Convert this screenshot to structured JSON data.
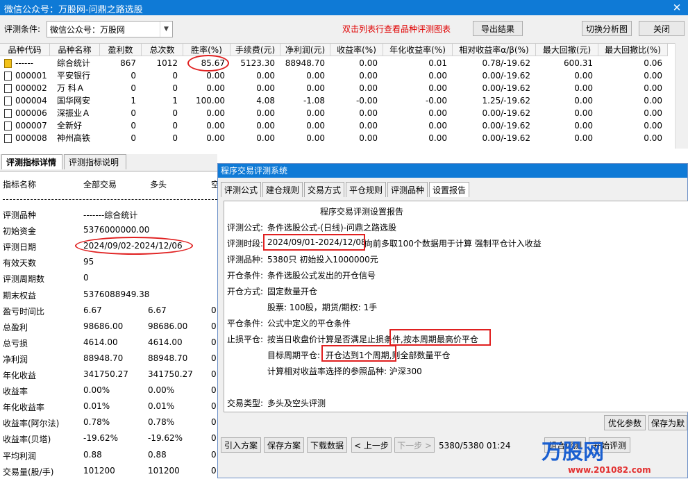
{
  "window": {
    "title": "微信公众号：万股网-问鼎之路选股",
    "close_glyph": "✕"
  },
  "toolbar": {
    "condition_label": "评测条件:",
    "condition_value": "微信公众号：万股网",
    "hint": "双击列表行查看品种评测图表",
    "export_label": "导出结果",
    "switch_label": "切换分析图",
    "close_label": "关闭"
  },
  "grid": {
    "headers": [
      "品种代码",
      "品种名称",
      "盈利数",
      "总次数",
      "胜率(%)",
      "手续费(元)",
      "净利润(元)",
      "收益率(%)",
      "年化收益率(%)",
      "相对收益率α/β(%)",
      "最大回撤(元)",
      "最大回撤比(%)"
    ],
    "rows": [
      [
        "------",
        "综合统计",
        "867",
        "1012",
        "85.67",
        "5123.30",
        "88948.70",
        "0.00",
        "0.01",
        "0.78/-19.62",
        "600.31",
        "0.06"
      ],
      [
        "000001",
        "平安银行",
        "0",
        "0",
        "0.00",
        "0.00",
        "0.00",
        "0.00",
        "0.00",
        "0.00/-19.62",
        "0.00",
        "0.00"
      ],
      [
        "000002",
        "万 科Ａ",
        "0",
        "0",
        "0.00",
        "0.00",
        "0.00",
        "0.00",
        "0.00",
        "0.00/-19.62",
        "0.00",
        "0.00"
      ],
      [
        "000004",
        "国华网安",
        "1",
        "1",
        "100.00",
        "4.08",
        "-1.08",
        "-0.00",
        "-0.00",
        "1.25/-19.62",
        "0.00",
        "0.00"
      ],
      [
        "000006",
        "深振业Ａ",
        "0",
        "0",
        "0.00",
        "0.00",
        "0.00",
        "0.00",
        "0.00",
        "0.00/-19.62",
        "0.00",
        "0.00"
      ],
      [
        "000007",
        "全新好",
        "0",
        "0",
        "0.00",
        "0.00",
        "0.00",
        "0.00",
        "0.00",
        "0.00/-19.62",
        "0.00",
        "0.00"
      ],
      [
        "000008",
        "神州高铁",
        "0",
        "0",
        "0.00",
        "0.00",
        "0.00",
        "0.00",
        "0.00",
        "0.00/-19.62",
        "0.00",
        "0.00"
      ]
    ]
  },
  "left_tabs": [
    "评测指标详情",
    "评测指标说明"
  ],
  "left_panel": {
    "headers": [
      "指标名称",
      "全部交易",
      "多头",
      "空"
    ],
    "rows": [
      [
        "评测品种",
        "-------综合统计",
        "",
        ""
      ],
      [
        "初始资金",
        "5376000000.00",
        "",
        ""
      ],
      [
        "评测日期",
        "2024/09/02-2024/12/06",
        "",
        ""
      ],
      [
        "有效天数",
        "95",
        "",
        ""
      ],
      [
        "评测周期数",
        "0",
        "",
        ""
      ],
      [
        "期末权益",
        "5376088949.38",
        "",
        ""
      ],
      [
        "盈亏时间比",
        "6.67",
        "6.67",
        "0"
      ],
      [
        "总盈利",
        "98686.00",
        "98686.00",
        "0"
      ],
      [
        "总亏损",
        "4614.00",
        "4614.00",
        "0"
      ],
      [
        "净利润",
        "88948.70",
        "88948.70",
        "0"
      ],
      [
        "年化收益",
        "341750.27",
        "341750.27",
        "0"
      ],
      [
        "收益率",
        "0.00%",
        "0.00%",
        "0"
      ],
      [
        "年化收益率",
        "0.01%",
        "0.01%",
        "0"
      ],
      [
        "收益率(阿尔法)",
        "0.78%",
        "0.78%",
        "0"
      ],
      [
        "收益率(贝塔)",
        "-19.62%",
        "-19.62%",
        "0"
      ],
      [
        "平均利润",
        "0.88",
        "0.88",
        "0"
      ],
      [
        "交易量(股/手)",
        "101200",
        "101200",
        "0"
      ]
    ]
  },
  "dialog": {
    "title": "程序交易评测系统",
    "tabs": [
      "评测公式",
      "建仓规则",
      "交易方式",
      "平仓规则",
      "评测品种",
      "设置报告"
    ],
    "report_title": "程序交易评测设置报告",
    "lines": {
      "formula_label": "评测公式:",
      "formula_value": "条件选股公式-(日线)-问鼎之路选股",
      "period_label": "评测时段:",
      "period_value": "2024/09/01-2024/12/08",
      "period_suffix": "向前多取100个数据用于计算 强制平仓计入收益",
      "variety_label": "评测品种:",
      "variety_value": "5380只 初始投入1000000元",
      "open_cond_label": "开仓条件:",
      "open_cond_value": "条件选股公式发出的开仓信号",
      "open_mode_label": "开仓方式:",
      "open_mode_value": "固定数量开仓",
      "stock_qty": "股票: 100股，期货/期权: 1手",
      "close_cond_label": "平仓条件:",
      "close_cond_value": "公式中定义的平仓条件",
      "stop_label": "止损平仓:",
      "stop_value": "按当日收盘价计算是否满足止损条件,按本周期最高价平仓",
      "target_label": "目标周期平仓:",
      "target_value": "开仓达到1个周期,则全部数量平仓",
      "relative_value": "计算相对收益率选择的参照品种: 沪深300",
      "trade_type_label": "交易类型:",
      "trade_type_value": "多头及空头评测"
    },
    "buttons": {
      "optimize": "优化参数",
      "save_default": "保存为默认",
      "import": "引入方案",
      "save_plan": "保存方案",
      "download": "下载数据",
      "prev": "< 上一步",
      "next": "下一步 >",
      "combo_eval": "组合评测",
      "start_eval": "开始评测"
    },
    "status": "5380/5380  01:24"
  },
  "watermark": {
    "brand": "万股网",
    "url": "www.201082.com"
  }
}
